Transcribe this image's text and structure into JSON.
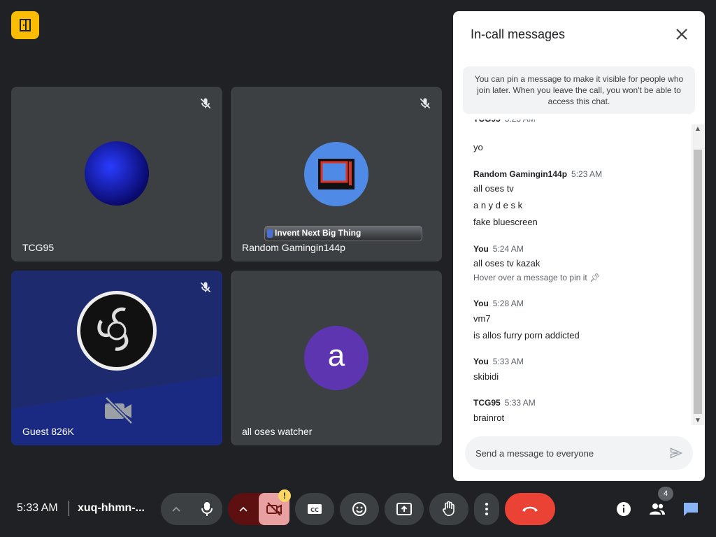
{
  "participants": [
    {
      "name": "TCG95"
    },
    {
      "name": "Random Gamingin144p",
      "banner": "Invent Next Big Thing"
    },
    {
      "name": "Guest 826K"
    },
    {
      "name": "all oses watcher",
      "initial": "a"
    }
  ],
  "chat": {
    "title": "In-call messages",
    "pin_note": "You can pin a message to make it visible for people who join later. When you leave the call, you won't be able to access this chat.",
    "messages": [
      {
        "text": "yo"
      },
      {
        "sender": "Random Gamingin144p",
        "time": "5:23 AM",
        "lines": [
          "all oses tv",
          "a n y d e s k",
          "fake bluescreen"
        ]
      },
      {
        "sender": "You",
        "time": "5:24 AM",
        "lines": [
          "all oses tv kazak"
        ],
        "hint": "Hover over a message to pin it"
      },
      {
        "sender": "You",
        "time": "5:28 AM",
        "lines": [
          "vm7",
          "is allos furry porn addicted"
        ]
      },
      {
        "sender": "You",
        "time": "5:33 AM",
        "lines": [
          "skibidi"
        ]
      },
      {
        "sender": "TCG95",
        "time": "5:33 AM",
        "lines": [
          "brainrot"
        ]
      }
    ],
    "compose_placeholder": "Send a message to everyone"
  },
  "bottom_bar": {
    "time": "5:33 AM",
    "meeting_code": "xuq-hhmn-...",
    "camera_warning": "!",
    "participant_count": "4"
  },
  "colors": {
    "accent": "#8ab4f8",
    "end_call": "#ea4335",
    "logo": "#fbbc04"
  }
}
